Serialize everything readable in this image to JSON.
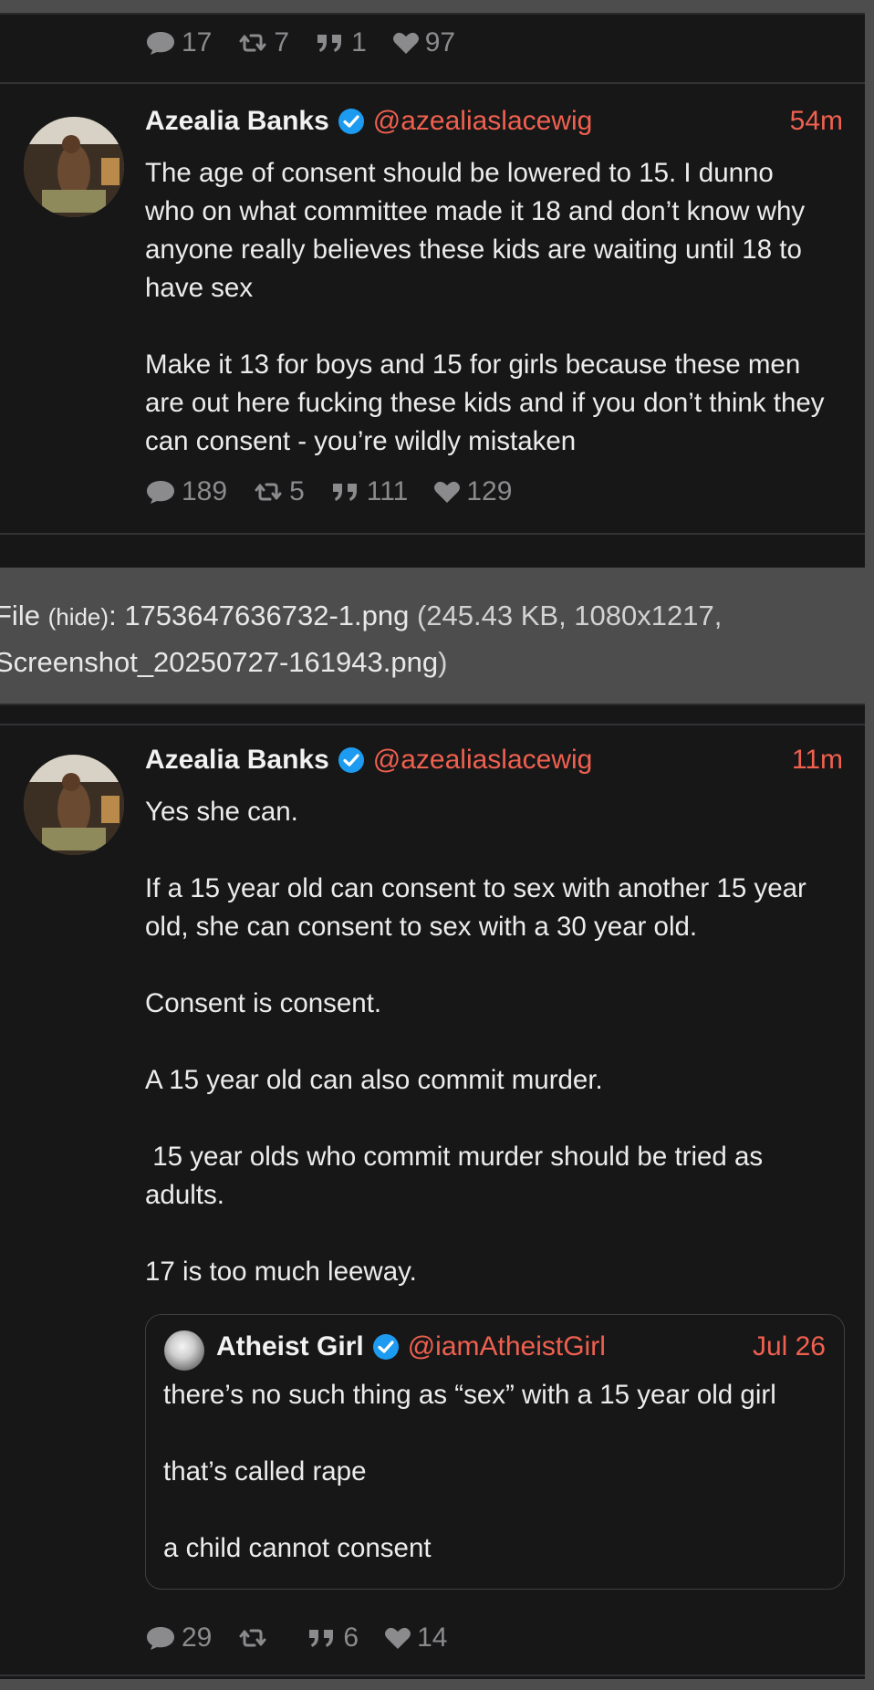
{
  "prev_tweet_stats": {
    "replies": "17",
    "retweets": "7",
    "quotes": "1",
    "likes": "97"
  },
  "tweet1": {
    "author_name": "Azealia Banks",
    "handle": "@azealiaslacewig",
    "time": "54m",
    "paragraphs": [
      "The age of consent should be lowered to 15. I dunno who on what committee made it 18 and don’t know why anyone really believes these kids are waiting until 18 to have sex",
      "Make it 13 for boys and 15 for girls because these men are out here fucking these kids and if you don’t think they can consent - you’re wildly mistaken"
    ],
    "stats": {
      "replies": "189",
      "retweets": "5",
      "quotes": "111",
      "likes": "129"
    }
  },
  "file_info": {
    "label": "File",
    "hide": "(hide)",
    "filename": "1753647636732-1.png",
    "meta": "(245.43 KB, 1080x1217,",
    "original_name": "Screenshot_20250727-161943.png",
    "close_paren": ")"
  },
  "tweet2": {
    "author_name": "Azealia Banks",
    "handle": "@azealiaslacewig",
    "time": "11m",
    "paragraphs": [
      "Yes she can.",
      "If a 15 year old can consent to sex with another 15 year old, she can consent to sex with a 30 year old.",
      "Consent is consent.",
      "A 15 year old can also commit murder.",
      " 15 year olds who commit murder should be tried as adults.",
      "17 is too much leeway."
    ],
    "quote": {
      "author_name": "Atheist Girl",
      "handle": "@iamAtheistGirl",
      "time": "Jul 26",
      "paragraphs": [
        "there’s no such thing as “sex” with a 15 year old girl",
        "that’s called rape",
        "a child cannot consent"
      ]
    },
    "stats": {
      "replies": "29",
      "retweets": "",
      "quotes": "6",
      "likes": "14"
    }
  },
  "colors": {
    "background": "#171718",
    "accent": "#f0604f",
    "verified": "#1d9bf0",
    "muted": "#8b8b8e"
  }
}
